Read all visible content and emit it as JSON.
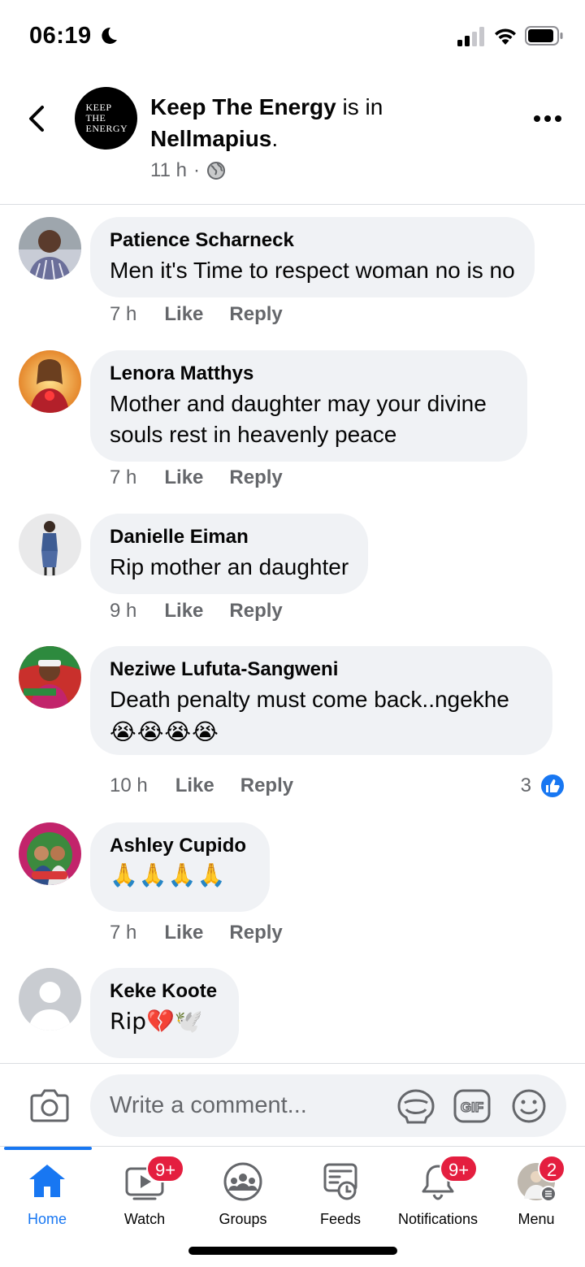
{
  "status_bar": {
    "time": "06:19"
  },
  "header": {
    "page_name": "Keep The Energy",
    "is_in": " is in ",
    "location": "Nellmapius",
    "period": ".",
    "time_ago": "11 h",
    "dot": "·",
    "avatar_logo_lines": [
      "KEEP",
      "THE",
      "ENERGY"
    ]
  },
  "comments": [
    {
      "name": "Patience Scharneck",
      "text": "Men it's Time to respect woman no is no",
      "time": "7 h",
      "like": "Like",
      "reply": "Reply"
    },
    {
      "name": "Lenora Matthys",
      "text": "Mother and daughter may your divine souls rest in heavenly peace",
      "time": "7 h",
      "like": "Like",
      "reply": "Reply"
    },
    {
      "name": "Danielle Eiman",
      "text": "Rip mother an daughter",
      "time": "9 h",
      "like": "Like",
      "reply": "Reply"
    },
    {
      "name": "Neziwe Lufuta-Sangweni",
      "text": "Death penalty must come back..ngekhe",
      "emojis": "😭😭😭😭",
      "time": "10 h",
      "like": "Like",
      "reply": "Reply",
      "reaction_count": "3"
    },
    {
      "name": "Ashley Cupido",
      "emojis": "🙏🙏🙏🙏",
      "time": "7 h",
      "like": "Like",
      "reply": "Reply"
    },
    {
      "name": "Keke Koote",
      "text": "Rip💔🕊️"
    }
  ],
  "composer": {
    "placeholder": "Write a comment..."
  },
  "tabs": [
    {
      "label": "Home"
    },
    {
      "label": "Watch",
      "badge": "9+"
    },
    {
      "label": "Groups"
    },
    {
      "label": "Feeds"
    },
    {
      "label": "Notifications",
      "badge": "9+"
    },
    {
      "label": "Menu",
      "badge": "2"
    }
  ],
  "colors": {
    "accent": "#1877f2",
    "badge": "#e41e3f",
    "bubble": "#f0f2f5",
    "secondary_text": "#65676b"
  }
}
